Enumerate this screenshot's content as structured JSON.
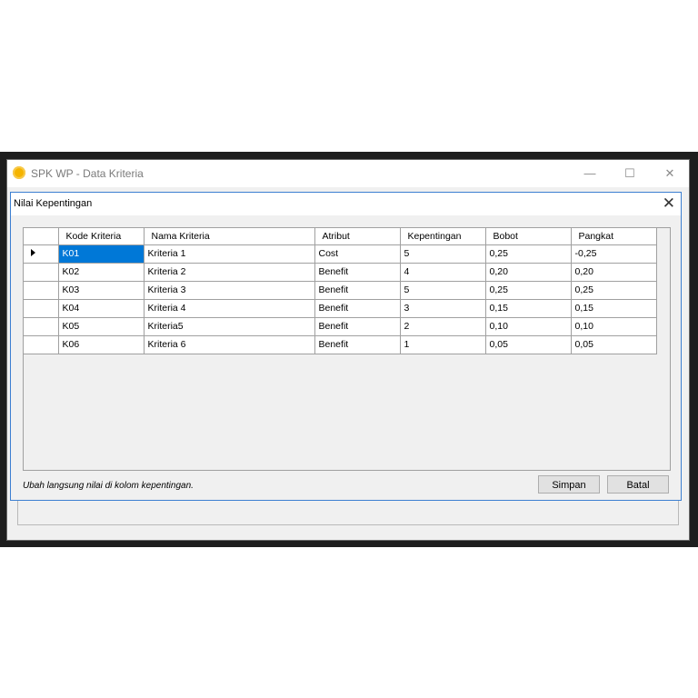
{
  "outer_window": {
    "title": "SPK WP - Data Kriteria",
    "minimize_glyph": "—",
    "maximize_glyph": "☐",
    "close_glyph": "✕"
  },
  "dialog": {
    "title": "Nilai Kepentingan",
    "close_glyph": "✕"
  },
  "grid": {
    "columns": [
      "Kode Kriteria",
      "Nama Kriteria",
      "Atribut",
      "Kepentingan",
      "Bobot",
      "Pangkat"
    ],
    "rows": [
      [
        "K01",
        "Kriteria 1",
        "Cost",
        "5",
        "0,25",
        "-0,25"
      ],
      [
        "K02",
        "Kriteria 2",
        "Benefit",
        "4",
        "0,20",
        "0,20"
      ],
      [
        "K03",
        "Kriteria 3",
        "Benefit",
        "5",
        "0,25",
        "0,25"
      ],
      [
        "K04",
        "Kriteria 4",
        "Benefit",
        "3",
        "0,15",
        "0,15"
      ],
      [
        "K05",
        "Kriteria5",
        "Benefit",
        "2",
        "0,10",
        "0,10"
      ],
      [
        "K06",
        "Kriteria 6",
        "Benefit",
        "1",
        "0,05",
        "0,05"
      ]
    ]
  },
  "footer": {
    "hint": "Ubah langsung nilai di kolom kepentingan.",
    "save_label": "Simpan",
    "cancel_label": "Batal"
  },
  "colors": {
    "selection": "#0078d7",
    "dialog_border": "#3c7fd1",
    "app_icon": "#f5b400"
  }
}
